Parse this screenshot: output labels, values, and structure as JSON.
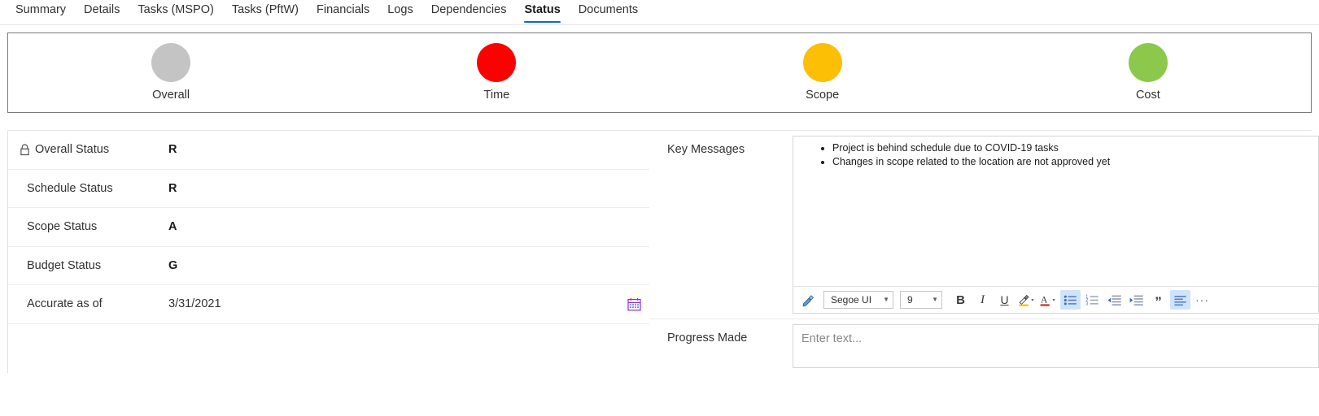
{
  "tabs": [
    {
      "label": "Summary",
      "active": false
    },
    {
      "label": "Details",
      "active": false
    },
    {
      "label": "Tasks (MSPO)",
      "active": false
    },
    {
      "label": "Tasks (PftW)",
      "active": false
    },
    {
      "label": "Financials",
      "active": false
    },
    {
      "label": "Logs",
      "active": false
    },
    {
      "label": "Dependencies",
      "active": false
    },
    {
      "label": "Status",
      "active": true
    },
    {
      "label": "Documents",
      "active": false
    }
  ],
  "status_indicators": [
    {
      "label": "Overall",
      "color": "#c4c4c4"
    },
    {
      "label": "Time",
      "color": "#ff0000"
    },
    {
      "label": "Scope",
      "color": "#fcbf06"
    },
    {
      "label": "Cost",
      "color": "#8cc84b"
    }
  ],
  "form": {
    "rows": [
      {
        "label": "Overall Status",
        "value": "R",
        "locked": true
      },
      {
        "label": "Schedule Status",
        "value": "R",
        "locked": false
      },
      {
        "label": "Scope Status",
        "value": "A",
        "locked": false
      },
      {
        "label": "Budget Status",
        "value": "G",
        "locked": false
      }
    ],
    "date_row": {
      "label": "Accurate as of",
      "value": "3/31/2021"
    }
  },
  "key_messages": {
    "label": "Key Messages",
    "bullets": [
      "Project is behind schedule due to COVID-19 tasks",
      "Changes in scope related to the location are not approved yet"
    ]
  },
  "progress_made": {
    "label": "Progress Made",
    "placeholder": "Enter text..."
  },
  "rte_toolbar": {
    "format_painter": "format-painter",
    "font_family": "Segoe UI",
    "font_size": "9",
    "bold": "B",
    "italic": "I",
    "underline": "U",
    "highlight": "A",
    "font_color": "A",
    "bulleted_list": "bulleted-list",
    "numbered_list": "numbered-list",
    "decrease_indent": "decrease-indent",
    "increase_indent": "increase-indent",
    "quote": "”",
    "align": "align-left",
    "overflow": "···"
  },
  "colors": {
    "accent": "#0f6cbd",
    "toolbar_active": "#cfe4fa",
    "panel_border": "#7a7a7a",
    "row_divider": "#ededed"
  }
}
